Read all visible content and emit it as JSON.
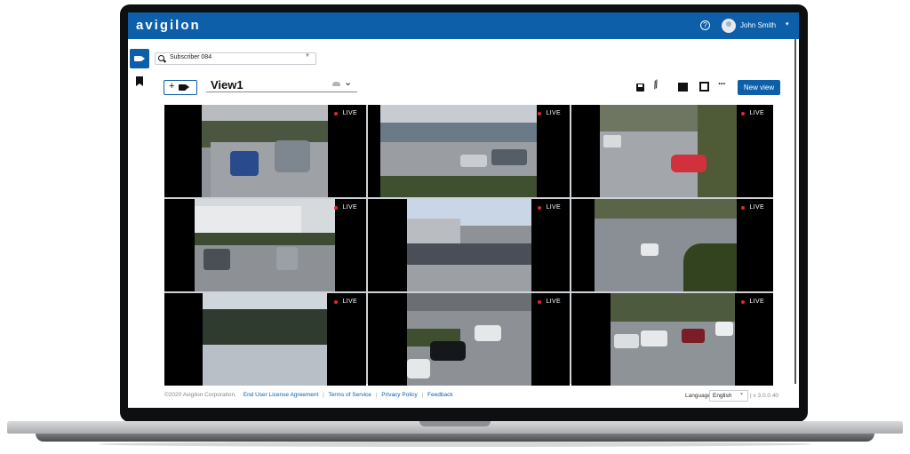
{
  "brand": {
    "logo_text": "avigilon",
    "color": "#0c5fa8"
  },
  "header": {
    "user_name": "John Smith",
    "help_icon": "question-circle-icon",
    "user_menu_caret": "▾"
  },
  "sidebar": {
    "items": [
      {
        "icon": "video-camera-icon",
        "active": true
      },
      {
        "icon": "bookmark-icon",
        "active": false
      }
    ]
  },
  "subscriber": {
    "value": "Subscriber 084"
  },
  "view": {
    "name": "View1",
    "chevron": "⌄"
  },
  "toolbar": {
    "icons": [
      "save-icon",
      "unlink-icon",
      "layout-icon",
      "fullscreen-icon",
      "more-icon"
    ],
    "more_label": "···",
    "new_view_label": "New view",
    "add_camera_label": "+"
  },
  "grid": {
    "live_label": "LIVE",
    "tiles": [
      {
        "scene": "parking-lot-trees"
      },
      {
        "scene": "office-parking"
      },
      {
        "scene": "lot-red-car"
      },
      {
        "scene": "building-parking"
      },
      {
        "scene": "wide-parking-lot"
      },
      {
        "scene": "road-overview"
      },
      {
        "scene": "trees-snow"
      },
      {
        "scene": "intersection"
      },
      {
        "scene": "parked-cars"
      }
    ]
  },
  "footer": {
    "copyright": "©2020 Avigilon Corporation.",
    "links": [
      "End User License Agreement",
      "Terms of Service",
      "Privacy Policy",
      "Feedback"
    ],
    "language_label": "Language",
    "language_value": "English",
    "version": "v 3.0.0.40"
  }
}
